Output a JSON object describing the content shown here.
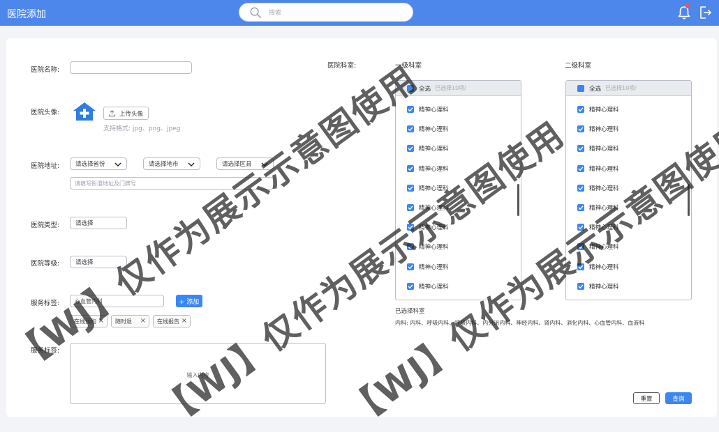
{
  "header": {
    "title": "医院添加",
    "search_placeholder": "搜索",
    "accent_color": "#4e87ec"
  },
  "form": {
    "name_label": "医院名称:",
    "name_value": "",
    "avatar_label": "医院头像:",
    "upload_label": "上传头像",
    "format_hint": "支持格式: jpg、png、jpeg",
    "address_label": "医院地址:",
    "province_placeholder": "请选择省份",
    "city_placeholder": "请选择地市",
    "district_placeholder": "请选择区县",
    "street_placeholder": "请填写街道地址及门牌号",
    "type_label": "医院类型:",
    "type_placeholder": "请选择",
    "level_label": "医院等级:",
    "level_placeholder": "请选择",
    "service_tag_label": "服务标签:",
    "service_tag_value": "心血管内科",
    "add_button": "+ 添加",
    "tags": [
      "在线预约",
      "随时退",
      "在线报告"
    ],
    "service_tag2_label": "服务标签:",
    "textarea_placeholder": "输入内容"
  },
  "departments": {
    "label": "医院科室:",
    "level1": {
      "title": "一级科室",
      "select_all": "全选",
      "selected_count": "已选择10项/",
      "items": [
        "精神心理科",
        "精神心理科",
        "精神心理科",
        "精神心理科",
        "精神心理科",
        "精神心理科",
        "精神心理科",
        "精神心理科",
        "精神心理科",
        "精神心理科"
      ]
    },
    "level2": {
      "title": "二级科室",
      "select_all": "全选",
      "selected_count": "已选择10项/",
      "items": [
        "精神心理科",
        "精神心理科",
        "精神心理科",
        "精神心理科",
        "精神心理科",
        "精神心理科",
        "精神心理科",
        "精神心理科",
        "精神心理科",
        "精神心理科"
      ]
    },
    "selected_title": "已选择科室",
    "selected_list": "内科: 内科、呼吸内科、呼吸内科、内分泌内科、神经内科、肾内科、消化内科、心血管内科、血液科"
  },
  "actions": {
    "reset": "重置",
    "query": "查询"
  },
  "watermark": [
    "【WJ】仅作为展示示意图使用",
    "【WJ】仅作为展示示意图使用",
    "【WJ】仅作为展示示意图使用"
  ]
}
